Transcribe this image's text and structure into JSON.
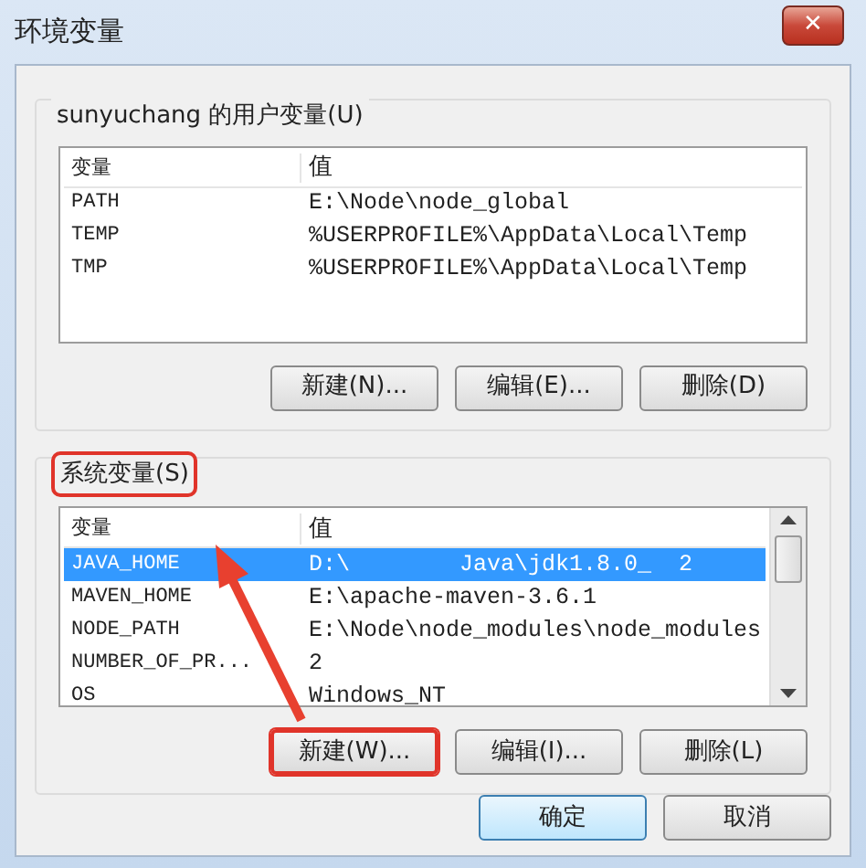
{
  "window": {
    "title": "环境变量",
    "close": "✕"
  },
  "user_vars": {
    "label": "sunyuchang 的用户变量(U)",
    "highlighted": false,
    "columns": [
      "变量",
      "值"
    ],
    "rows": [
      {
        "name": "PATH",
        "value": "E:\\Node\\node_global",
        "selected": false
      },
      {
        "name": "TEMP",
        "value": "%USERPROFILE%\\AppData\\Local\\Temp",
        "selected": false
      },
      {
        "name": "TMP",
        "value": "%USERPROFILE%\\AppData\\Local\\Temp",
        "selected": false
      }
    ],
    "buttons": [
      {
        "label": "新建(N)...",
        "highlighted": false
      },
      {
        "label": "编辑(E)...",
        "highlighted": false
      },
      {
        "label": "删除(D)",
        "highlighted": false
      }
    ]
  },
  "system_vars": {
    "label": "系统变量(S)",
    "highlighted": true,
    "columns": [
      "变量",
      "值"
    ],
    "rows": [
      {
        "name": "JAVA_HOME",
        "value": "D:\\        Java\\jdk1.8.0_  2",
        "selected": true
      },
      {
        "name": "MAVEN_HOME",
        "value": "E:\\apache-maven-3.6.1",
        "selected": false
      },
      {
        "name": "NODE_PATH",
        "value": "E:\\Node\\node_modules\\node_modules",
        "selected": false
      },
      {
        "name": "NUMBER_OF_PR...",
        "value": "2",
        "selected": false
      },
      {
        "name": "OS",
        "value": "Windows_NT",
        "selected": false
      }
    ],
    "buttons": [
      {
        "label": "新建(W)...",
        "highlighted": true
      },
      {
        "label": "编辑(I)...",
        "highlighted": false
      },
      {
        "label": "删除(L)",
        "highlighted": false
      }
    ]
  },
  "footer_buttons": [
    {
      "label": "确定",
      "default": true
    },
    {
      "label": "取消",
      "default": false
    }
  ]
}
